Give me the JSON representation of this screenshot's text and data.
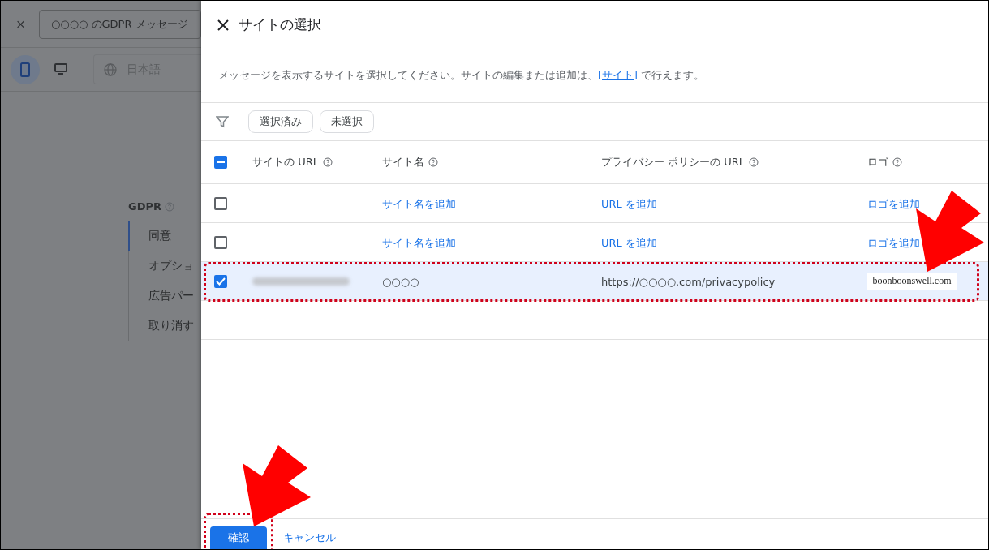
{
  "background": {
    "title_field": "○○○○ のGDPR メッセージ",
    "devices": [
      {
        "kind": "mobile",
        "selected": true
      },
      {
        "kind": "desktop",
        "selected": false
      }
    ],
    "language_field": "日本語",
    "nav": {
      "heading": "GDPR",
      "items": [
        {
          "label": "同意",
          "selected": true
        },
        {
          "label": "オプショ",
          "selected": false
        },
        {
          "label": "広告パー",
          "selected": false
        },
        {
          "label": "取り消す",
          "selected": false
        }
      ]
    }
  },
  "dialog": {
    "title": "サイトの選択",
    "description": "メッセージを表示するサイトを選択してください。サイトの編集または追加は、",
    "description_link": "[サイト]",
    "description_end": " で行えます。",
    "filters": [
      {
        "label": "選択済み",
        "selected": false
      },
      {
        "label": "未選択",
        "selected": false
      }
    ],
    "table": {
      "select_all": {
        "indeterminate": true
      },
      "columns": [
        "サイトの URL",
        "サイト名",
        "プライバシー ポリシーの URL",
        "ロゴ"
      ],
      "rows": [
        {
          "checked": false,
          "cells": [
            {
              "kind": "empty"
            },
            {
              "kind": "link",
              "text": "サイト名を追加"
            },
            {
              "kind": "link",
              "text": "URL を追加"
            },
            {
              "kind": "link",
              "text": "ロゴを追加"
            }
          ]
        },
        {
          "checked": false,
          "cells": [
            {
              "kind": "empty"
            },
            {
              "kind": "link",
              "text": "サイト名を追加"
            },
            {
              "kind": "link",
              "text": "URL を追加"
            },
            {
              "kind": "link",
              "text": "ロゴを追加"
            }
          ]
        },
        {
          "checked": true,
          "cells": [
            {
              "kind": "blurred"
            },
            {
              "kind": "text",
              "text": "○○○○"
            },
            {
              "kind": "text",
              "text": "https://○○○○.com/privacypolicy"
            },
            {
              "kind": "logo",
              "text": "boonboonswell.com"
            }
          ]
        }
      ]
    },
    "buttons": [
      {
        "label": "確認",
        "kind": "primary"
      },
      {
        "label": "キャンセル",
        "kind": "text"
      }
    ]
  }
}
